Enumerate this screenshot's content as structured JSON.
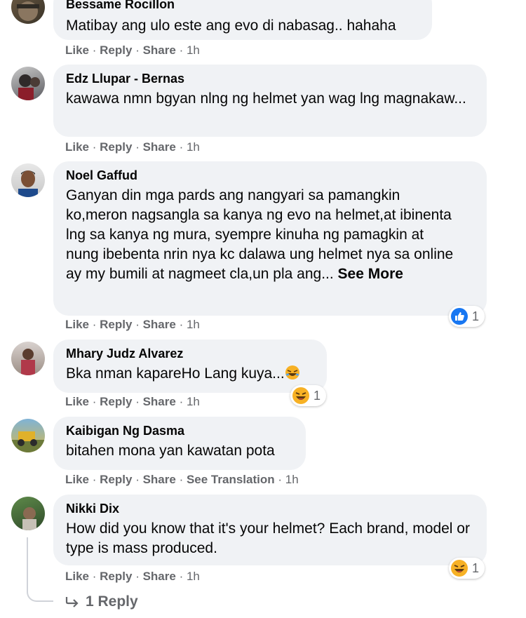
{
  "comments": [
    {
      "author": "Bessame Rocillon",
      "text": "Matibay ang ulo este ang evo di nabasag.. hahaha",
      "actions": {
        "like": "Like",
        "reply": "Reply",
        "share": "Share",
        "time": "1h"
      }
    },
    {
      "author": "Edz Llupar - Bernas",
      "text": "kawawa nmn bgyan nlng ng helmet yan wag lng magnakaw...",
      "actions": {
        "like": "Like",
        "reply": "Reply",
        "share": "Share",
        "time": "1h"
      }
    },
    {
      "author": "Noel Gaffud",
      "text": "Ganyan din mga pards ang nangyari sa pamangkin ko,meron nagsangla sa kanya ng evo na helmet,at ibinenta lng sa kanya ng mura, syempre kinuha ng pamagkin at nung ibebenta nrin nya kc dalawa ung helmet nya sa online ay my bumili at nagmeet cla,un pla ang...",
      "see_more": "See More",
      "reaction": {
        "icon": "like-reaction-icon",
        "count": "1"
      },
      "actions": {
        "like": "Like",
        "reply": "Reply",
        "share": "Share",
        "time": "1h"
      }
    },
    {
      "author": "Mhary Judz Alvarez",
      "text": "Bka nman kapareHo Lang kuya...",
      "emoji": "laughing-emoji-icon",
      "reaction": {
        "icon": "haha-reaction-icon",
        "count": "1"
      },
      "actions": {
        "like": "Like",
        "reply": "Reply",
        "share": "Share",
        "time": "1h"
      }
    },
    {
      "author": "Kaibigan Ng Dasma",
      "text": "bitahen mona yan kawatan pota",
      "actions": {
        "like": "Like",
        "reply": "Reply",
        "share": "Share",
        "translate": "See Translation",
        "time": "1h"
      }
    },
    {
      "author": "Nikki Dix",
      "text": "How did you know that it's your helmet? Each brand, model or type is mass produced.",
      "reaction": {
        "icon": "haha-reaction-icon",
        "count": "1"
      },
      "actions": {
        "like": "Like",
        "reply": "Reply",
        "share": "Share",
        "time": "1h"
      }
    }
  ],
  "replies_link": "1 Reply",
  "separator": "·",
  "colors": {
    "bubble": "#f0f2f5",
    "meta": "#65676b",
    "like_blue": "#1877f2",
    "haha_yellow": "#f7b125"
  }
}
